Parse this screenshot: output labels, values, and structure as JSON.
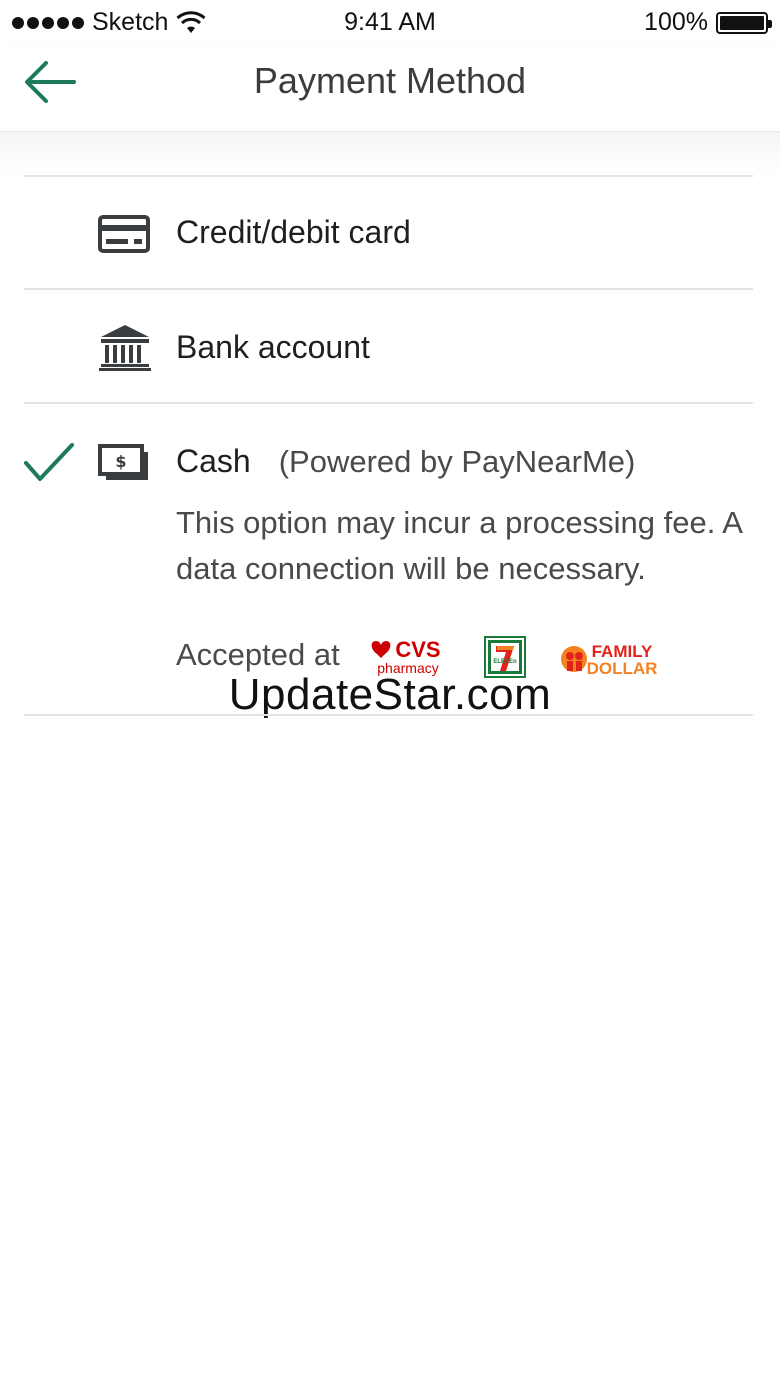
{
  "status_bar": {
    "carrier": "Sketch",
    "time": "9:41 AM",
    "battery": "100%"
  },
  "nav": {
    "title": "Payment Method"
  },
  "options": [
    {
      "label": "Credit/debit card",
      "icon": "credit-card-icon",
      "selected": false
    },
    {
      "label": "Bank account",
      "icon": "bank-icon",
      "selected": false
    },
    {
      "label": "Cash",
      "sub_label": "(Powered by PayNearMe)",
      "icon": "cash-icon",
      "selected": true
    }
  ],
  "cash_details": {
    "description": "This option may incur a processing fee. A data connection will be necessary.",
    "accepted_label": "Accepted at",
    "logos": [
      "CVS pharmacy",
      "7-Eleven",
      "Family Dollar"
    ]
  },
  "watermark": "UpdateStar.com",
  "colors": {
    "accent": "#1d7a5a",
    "icon": "#3a3d40",
    "divider": "#e3e3e3"
  }
}
